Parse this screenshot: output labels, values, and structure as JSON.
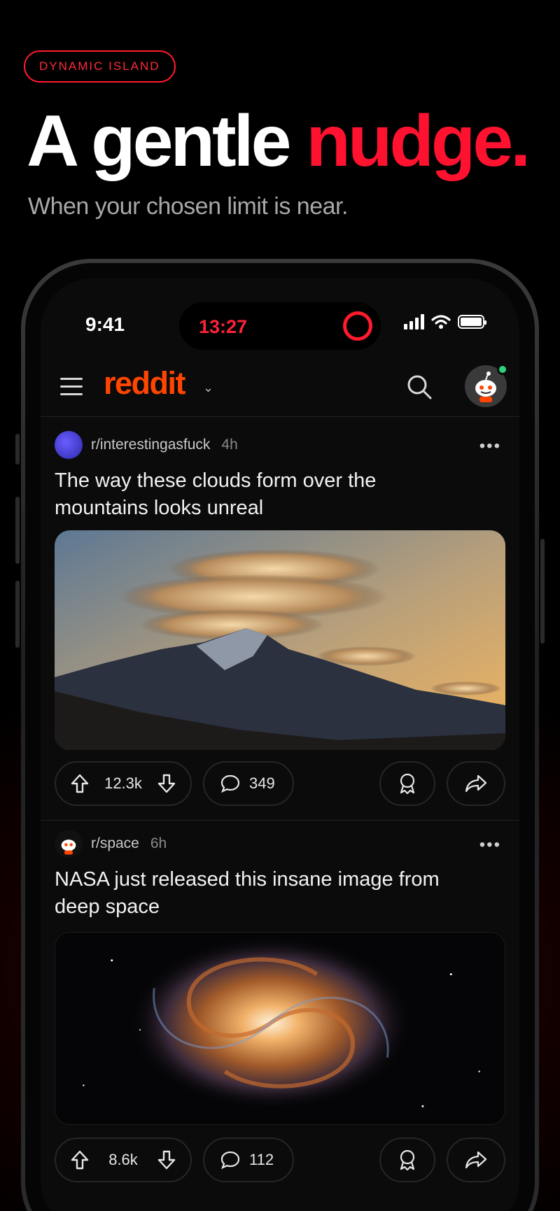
{
  "marketing": {
    "badge": "DYNAMIC ISLAND",
    "headline_main": "A gentle",
    "headline_accent": "nudge.",
    "subhead": "When your chosen limit is near."
  },
  "status_bar": {
    "time": "9:41",
    "island_timer": "13:27"
  },
  "app": {
    "logo": "reddit"
  },
  "posts": [
    {
      "subreddit": "r/interestingasfuck",
      "age": "4h",
      "title": "The way these clouds form over the mountains looks unreal",
      "upvotes": "12.3k",
      "comments": "349",
      "image": "lenticular clouds over mountain peaks at sunset"
    },
    {
      "subreddit": "r/space",
      "age": "6h",
      "title": "NASA just released this insane image from deep space",
      "upvotes": "8.6k",
      "comments": "112",
      "image": "spiral galaxy in deep space"
    }
  ],
  "colors": {
    "accent_red": "#ff1230",
    "reddit_orange": "#ff4500",
    "background": "#000000"
  }
}
